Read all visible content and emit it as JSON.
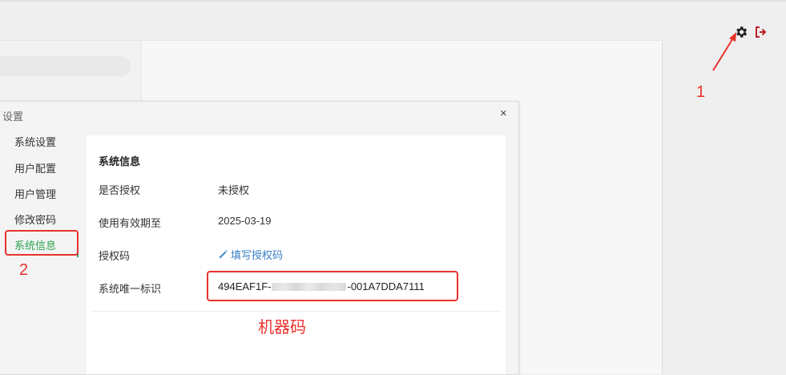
{
  "dialog": {
    "title": "设置",
    "close_glyph": "×",
    "nav": [
      {
        "label": "系统设置"
      },
      {
        "label": "用户配置"
      },
      {
        "label": "用户管理"
      },
      {
        "label": "修改密码"
      },
      {
        "label": "系统信息",
        "active": true
      }
    ],
    "system_info": {
      "section_title": "系统信息",
      "authorized_label": "是否授权",
      "authorized_value": "未授权",
      "expiry_label": "使用有效期至",
      "expiry_value": "2025-03-19",
      "auth_code_label": "授权码",
      "auth_code_link": "填写授权码",
      "uid_label": "系统唯一标识",
      "uid_prefix": "494EAF1F-",
      "uid_suffix": "-001A7DDA7111"
    }
  },
  "header_icons": [
    "gear-icon",
    "logout-icon"
  ],
  "annotations": {
    "step1": "1",
    "step2": "2",
    "machine_code": "机器码"
  },
  "colors": {
    "accent_green": "#2aa44f",
    "annotation_red": "#e8322c",
    "link_blue": "#3a7fc4",
    "logout_red": "#b8212b"
  }
}
